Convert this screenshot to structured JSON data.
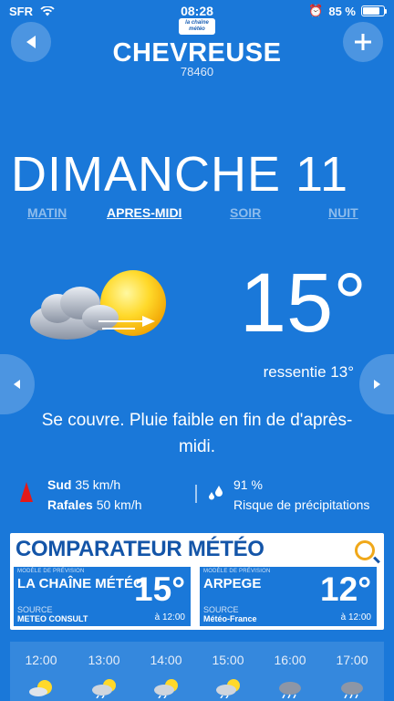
{
  "status": {
    "carrier": "SFR",
    "time": "08:28",
    "battery": "85 %"
  },
  "header": {
    "back_icon": "chevron-left-icon",
    "add_icon": "plus-icon",
    "logo_text": "la chaîne météo",
    "city": "CHEVREUSE",
    "postcode": "78460"
  },
  "day": {
    "title": "DIMANCHE 11",
    "tabs": [
      {
        "label": "MATIN",
        "active": false
      },
      {
        "label": "APRES-MIDI",
        "active": true
      },
      {
        "label": "SOIR",
        "active": false
      },
      {
        "label": "NUIT",
        "active": false
      }
    ]
  },
  "current": {
    "icon": "sun-cloud-wind-icon",
    "temperature": "15°",
    "feels_like": "ressentie 13°",
    "description": "Se couvre. Pluie faible en fin de d'après-midi."
  },
  "wind": {
    "direction": "Sud",
    "speed": "35 km/h",
    "gusts_label": "Rafales",
    "gusts": "50 km/h"
  },
  "rain": {
    "percent": "91 %",
    "label": "Risque de précipitations"
  },
  "comparator": {
    "title": "COMPARATEUR MÉTÉO",
    "models": [
      {
        "model_label": "MODÈLE DE PRÉVISION",
        "name": "LA CHAÎNE MÉTÉO",
        "temp": "15°",
        "source_label": "SOURCE",
        "source": "METEO CONSULT",
        "time": "à 12:00"
      },
      {
        "model_label": "MODÈLE DE PRÉVISION",
        "name": "ARPEGE",
        "temp": "12°",
        "source_label": "SOURCE",
        "source": "Météo-France",
        "time": "à 12:00"
      }
    ]
  },
  "hourly": [
    {
      "time": "12:00",
      "icon": "sun-cloud-icon"
    },
    {
      "time": "13:00",
      "icon": "cloud-sun-rain-icon"
    },
    {
      "time": "14:00",
      "icon": "cloud-sun-rain-icon"
    },
    {
      "time": "15:00",
      "icon": "cloud-sun-rain-icon"
    },
    {
      "time": "16:00",
      "icon": "rain-cloud-icon"
    },
    {
      "time": "17:00",
      "icon": "rain-cloud-icon"
    }
  ]
}
